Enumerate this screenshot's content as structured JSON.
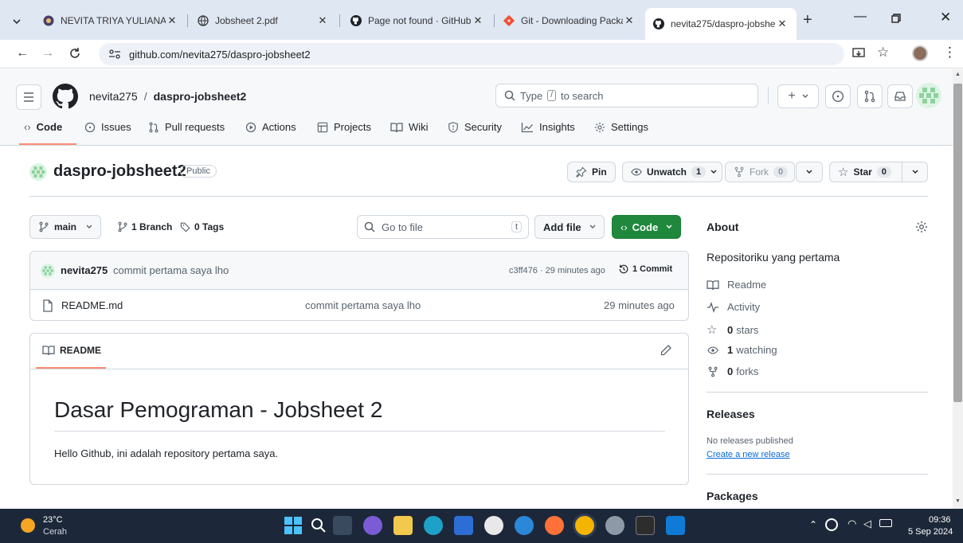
{
  "browser": {
    "tabs": [
      {
        "title": "NEVITA TRIYA YULIANA |"
      },
      {
        "title": "Jobsheet 2.pdf"
      },
      {
        "title": "Page not found · GitHub"
      },
      {
        "title": "Git - Downloading Packa"
      },
      {
        "title": "nevita275/daspro-jobshe"
      }
    ],
    "url": "github.com/nevita275/daspro-jobsheet2"
  },
  "header": {
    "owner": "nevita275",
    "separator": "/",
    "repo": "daspro-jobsheet2",
    "search_placeholder": "Type",
    "search_key": "/",
    "search_suffix": "to search"
  },
  "nav": {
    "tabs": [
      "Code",
      "Issues",
      "Pull requests",
      "Actions",
      "Projects",
      "Wiki",
      "Security",
      "Insights",
      "Settings"
    ]
  },
  "repo": {
    "name": "daspro-jobsheet2",
    "visibility": "Public",
    "pin_label": "Pin",
    "unwatch_label": "Unwatch",
    "watch_count": "1",
    "fork_label": "Fork",
    "fork_count": "0",
    "star_label": "Star",
    "star_count": "0"
  },
  "toolbar": {
    "branch": "main",
    "branches": "1 Branch",
    "tags": "0 Tags",
    "goto_placeholder": "Go to file",
    "goto_key": "t",
    "add_file": "Add file",
    "code": "Code"
  },
  "commit": {
    "author": "nevita275",
    "message": "commit pertama saya lho",
    "hash_time": "c3ff476 · 29 minutes ago",
    "commits": "1 Commit"
  },
  "files": [
    {
      "name": "README.md",
      "message": "commit pertama saya lho",
      "time": "29 minutes ago"
    }
  ],
  "readme": {
    "tab": "README",
    "heading": "Dasar Pemograman - Jobsheet 2",
    "body": "Hello Github, ini adalah repository pertama saya."
  },
  "about": {
    "title": "About",
    "description": "Repositoriku yang pertama",
    "readme": "Readme",
    "activity": "Activity",
    "stars_n": "0",
    "stars": "stars",
    "watching_n": "1",
    "watching": "watching",
    "forks_n": "0",
    "forks": "forks"
  },
  "releases": {
    "title": "Releases",
    "none": "No releases published",
    "create": "Create a new release"
  },
  "packages": {
    "title": "Packages"
  },
  "taskbar": {
    "temp": "23°C",
    "weather": "Cerah",
    "time": "09:36",
    "date": "5 Sep 2024"
  },
  "colors": {
    "accent_green": "#1f883d",
    "link_blue": "#0969da",
    "tab_underline": "#fd8c73"
  }
}
